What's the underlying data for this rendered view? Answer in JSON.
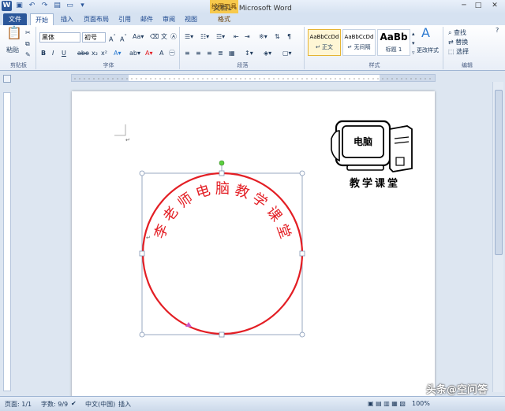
{
  "window": {
    "title": "文档1 - Microsoft Word",
    "contextual_tab": "绘图工具",
    "minimize": "─",
    "maximize": "□",
    "close": "✕"
  },
  "tabs": [
    {
      "label": "文件"
    },
    {
      "label": "开始"
    },
    {
      "label": "插入"
    },
    {
      "label": "页面布局"
    },
    {
      "label": "引用"
    },
    {
      "label": "邮件"
    },
    {
      "label": "审阅"
    },
    {
      "label": "视图"
    },
    {
      "label": "格式"
    }
  ],
  "ribbon": {
    "clipboard": {
      "label": "剪贴板",
      "paste": "粘贴"
    },
    "font": {
      "label": "字体",
      "name": "黑体",
      "size": "初号"
    },
    "paragraph": {
      "label": "段落"
    },
    "styles": {
      "label": "样式",
      "items": [
        {
          "preview": "AaBbCcDd",
          "name": "↵ 正文"
        },
        {
          "preview": "AaBbCcDd",
          "name": "↵ 无间隔"
        },
        {
          "preview": "AaBb",
          "name": "标题 1"
        }
      ],
      "change_styles": "更改样式"
    },
    "editing": {
      "label": "编辑",
      "find": "查找",
      "replace": "替换",
      "select": "选择"
    }
  },
  "document": {
    "logo": {
      "screen_text": "电脑",
      "caption": "教学课堂"
    },
    "stamp": {
      "text_chars": [
        "李",
        "老",
        "师",
        "电",
        "脑",
        "教",
        "学",
        "课",
        "堂"
      ],
      "color": "#e31e24"
    }
  },
  "statusbar": {
    "page": "页面: 1/1",
    "words": "字数: 9/9",
    "language": "中文(中国)",
    "mode": "插入",
    "zoom": "100%"
  },
  "watermark": "头条@空问答"
}
